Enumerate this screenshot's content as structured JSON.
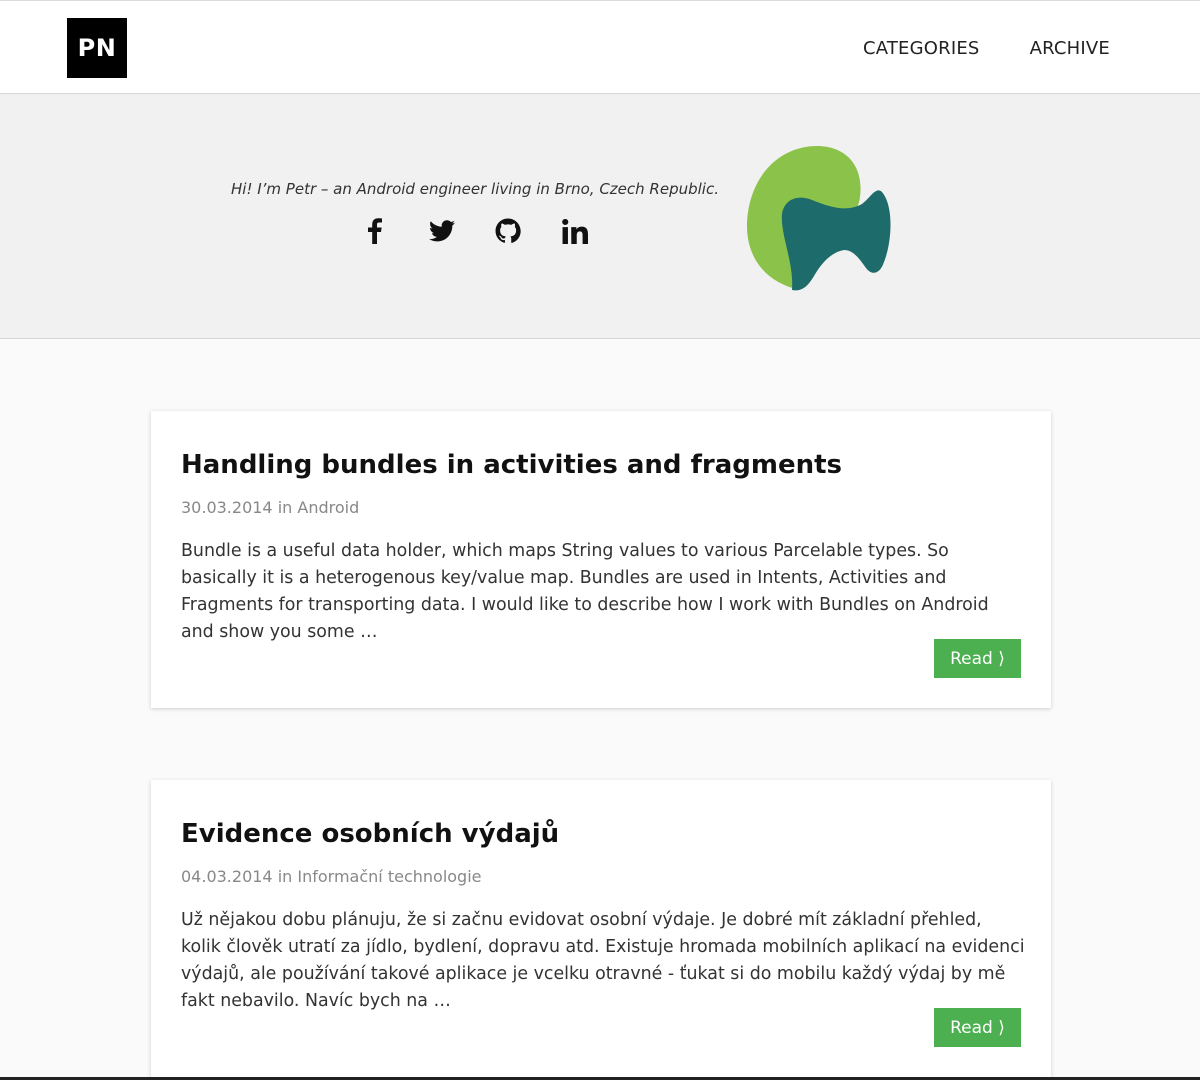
{
  "header": {
    "logo": "PN",
    "nav": [
      {
        "label": "CATEGORIES"
      },
      {
        "label": "ARCHIVE"
      }
    ]
  },
  "hero": {
    "intro": "Hi! I’m Petr – an Android engineer living in Brno, Czech Republic.",
    "social_icons": [
      "facebook-icon",
      "twitter-icon",
      "github-icon",
      "linkedin-icon"
    ],
    "brand_colors": {
      "green": "#8bc34a",
      "teal": "#1e6b6b"
    }
  },
  "posts": [
    {
      "title": "Handling bundles in activities and fragments",
      "date": "30.03.2014",
      "in": "in",
      "category": "Android",
      "excerpt": "Bundle is a useful data holder, which maps String values to various Parcelable types. So basically it is a heterogenous key/value map. Bundles are used in Intents, Activities and Fragments for transporting data. I would like to describe how I work with Bundles on Android and show you some …",
      "read_label": "Read ⟩"
    },
    {
      "title": "Evidence osobních výdajů",
      "date": "04.03.2014",
      "in": "in",
      "category": "Informační technologie",
      "excerpt": "Už nějakou dobu plánuju, že si začnu evidovat osobní výdaje. Je dobré mít základní přehled, kolik člověk utratí za jídlo, bydlení, dopravu atd. Existuje hromada mobilních aplikací na evidenci výdajů, ale používání takové aplikace je vcelku otravné - ťukat si do mobilu každý výdaj by mě fakt nebavilo. Navíc bych na …",
      "read_label": "Read ⟩"
    }
  ],
  "colors": {
    "accent": "#4caf50"
  }
}
